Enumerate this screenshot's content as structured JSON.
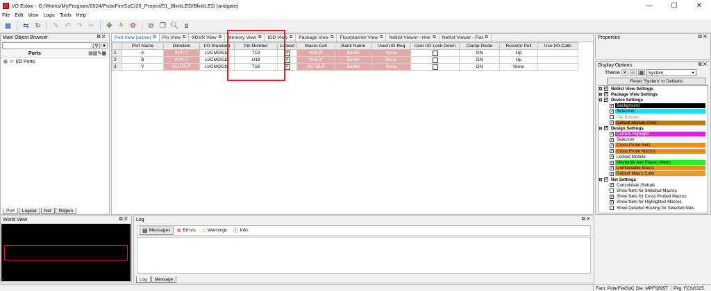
{
  "window": {
    "title": "I/O Editor - G:/Works/MyProgram/2024/PolarFireSoC/20_Project/01_BlinkLED/BlinkLED (andgate)"
  },
  "menu": [
    "File",
    "Edit",
    "View",
    "Logic",
    "Tools",
    "Help"
  ],
  "main_object_browser": {
    "title": "Main Object Browser",
    "column": "Ports",
    "tree_root": "I/O Ports",
    "tabs": [
      "Port",
      "Logical",
      "Net",
      "Region"
    ]
  },
  "view_tabs": [
    "Port View [active]",
    "Pin View",
    "XDVR View",
    "Memory View",
    "IOD View",
    "Package View",
    "Floorplanner View",
    "Netlist Viewer - Hier",
    "Netlist Viewer - Flat"
  ],
  "grid": {
    "columns": [
      "Port Name",
      "Direction",
      "I/O Standard",
      "Pin Number",
      "Locked",
      "Macro Cell",
      "Bank Name",
      "Used I/O Req",
      "User I/O Lock Down",
      "Clamp Diode",
      "Resistor Pull",
      "Use I/O Calib"
    ],
    "rows": [
      {
        "n": "1",
        "port": "A",
        "dir": "INPUT",
        "std": "LVCMOS18",
        "pin": "T19",
        "macro": "INBUF",
        "bank": "Bank0",
        "used": "None",
        "clamp": "ON",
        "pull": "Up"
      },
      {
        "n": "2",
        "port": "B",
        "dir": "INPUT",
        "std": "LVCMOS18",
        "pin": "U18",
        "macro": "INBUF",
        "bank": "Bank0",
        "used": "None",
        "clamp": "ON",
        "pull": "Up"
      },
      {
        "n": "3",
        "port": "Y",
        "dir": "OUTPUT",
        "std": "LVCMOS18",
        "pin": "T18",
        "macro": "OUTBUF",
        "bank": "Bank0",
        "used": "None",
        "clamp": "ON",
        "pull": "None"
      }
    ]
  },
  "properties": {
    "title": "Properties"
  },
  "display_options": {
    "title": "Display Options",
    "theme_label": "Theme",
    "theme_value": "System",
    "reset_label": "Reset 'System' to Defaults",
    "items": [
      {
        "label": "Netlist View Settings",
        "level": 0,
        "group": true,
        "checked": true
      },
      {
        "label": "Package View Settings",
        "level": 0,
        "group": true,
        "checked": true
      },
      {
        "label": "Device Settings",
        "level": 0,
        "group": true,
        "checked": true
      },
      {
        "label": "Background",
        "level": 1,
        "checked": true,
        "color": "#000000",
        "text": "#ffffff"
      },
      {
        "label": "Selection",
        "level": 1,
        "checked": true,
        "color": "#00e5ee",
        "text": "#000000"
      },
      {
        "label": "Tile Borders",
        "level": 1,
        "checked": false,
        "color": "",
        "text": "#888888"
      },
      {
        "label": "Default Module Color",
        "level": 1,
        "checked": true,
        "color": "#c07a10",
        "text": "#000000"
      },
      {
        "label": "Design Settings",
        "level": 0,
        "group": true,
        "checked": true
      },
      {
        "label": "Current Highlight",
        "level": 1,
        "checked": true,
        "color": "#e020e0",
        "text": "#ffffff"
      },
      {
        "label": "Selection",
        "level": 1,
        "checked": true,
        "color": "",
        "text": "#000000"
      },
      {
        "label": "Cross Probe Nets",
        "level": 1,
        "checked": true,
        "color": "#ff8c1a",
        "text": "#000000"
      },
      {
        "label": "Cross Probe Macros",
        "level": 1,
        "checked": true,
        "color": "#ff8c1a",
        "text": "#000000"
      },
      {
        "label": "Locked Module",
        "level": 1,
        "checked": true,
        "color": "",
        "text": "#000000"
      },
      {
        "label": "Moveable and Placed Macro",
        "level": 1,
        "checked": true,
        "color": "#22ee22",
        "text": "#000000"
      },
      {
        "label": "Unmoveable Macro",
        "level": 1,
        "checked": true,
        "color": "#ff8c1a",
        "text": "#000000"
      },
      {
        "label": "Default Macro Color",
        "level": 1,
        "checked": true,
        "color": "#e0a020",
        "text": "#000000"
      },
      {
        "label": "Net Settings",
        "level": 0,
        "group": true,
        "checked": true
      },
      {
        "label": "Consolidate Globals",
        "level": 1,
        "checked": true,
        "color": "",
        "text": "#000000"
      },
      {
        "label": "Show Nets for Selected Macros",
        "level": 1,
        "checked": false,
        "color": "",
        "text": "#000000"
      },
      {
        "label": "Show Nets for Cross Probed Macros",
        "level": 1,
        "checked": true,
        "color": "",
        "text": "#000000"
      },
      {
        "label": "Show Nets for Highlighted Macros",
        "level": 1,
        "checked": true,
        "color": "",
        "text": "#000000"
      },
      {
        "label": "Show Detailed Routing for Selected Nets",
        "level": 1,
        "checked": false,
        "color": "",
        "text": "#000000"
      }
    ]
  },
  "world_view": {
    "title": "World View"
  },
  "log": {
    "title": "Log",
    "filters": [
      "Messages",
      "Errors",
      "Warnings",
      "Info"
    ],
    "tabs": [
      "Log",
      "Message"
    ]
  },
  "status": {
    "fam": "Fam: PolarFireSoC",
    "die": "Die: MPFS095T",
    "pkg": "Pkg: FCSG325"
  }
}
